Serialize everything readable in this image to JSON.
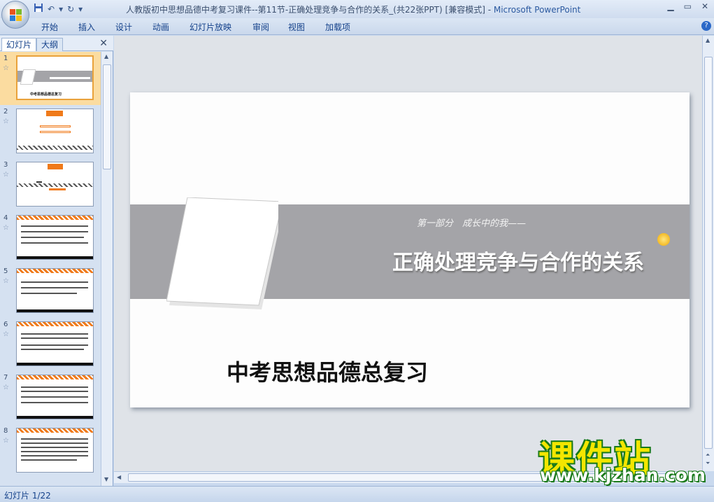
{
  "window": {
    "title": "人教版初中思想品德中考复习课件--第11节-正确处理竞争与合作的关系_(共22张PPT) [兼容模式] - ",
    "app_name": "Microsoft PowerPoint"
  },
  "quick_access": [
    "save",
    "undo",
    "redo",
    "customize"
  ],
  "ribbon_tabs": [
    "开始",
    "插入",
    "设计",
    "动画",
    "幻灯片放映",
    "审阅",
    "视图",
    "加载项"
  ],
  "left_panel": {
    "tabs": [
      "幻灯片",
      "大纲"
    ],
    "close": "✕",
    "slides": [
      {
        "num": "1",
        "selected": true
      },
      {
        "num": "2"
      },
      {
        "num": "3"
      },
      {
        "num": "4"
      },
      {
        "num": "5"
      },
      {
        "num": "6"
      },
      {
        "num": "7"
      },
      {
        "num": "8"
      }
    ],
    "thumb1_caption": "中考思想品德总复习"
  },
  "slide": {
    "subtitle": "第一部分　成长中的我——",
    "title": "正确处理竞争与合作的关系",
    "bottom_title": "中考思想品德总复习"
  },
  "watermark": {
    "cn": "课件站",
    "url": "www.kjzhan.com"
  },
  "status": {
    "slide_count": "幻灯片 1/22"
  },
  "colors": {
    "accent_orange": "#f07a1a",
    "band_gray": "#a4a4a8",
    "selected_thumb": "#fbdca0"
  }
}
